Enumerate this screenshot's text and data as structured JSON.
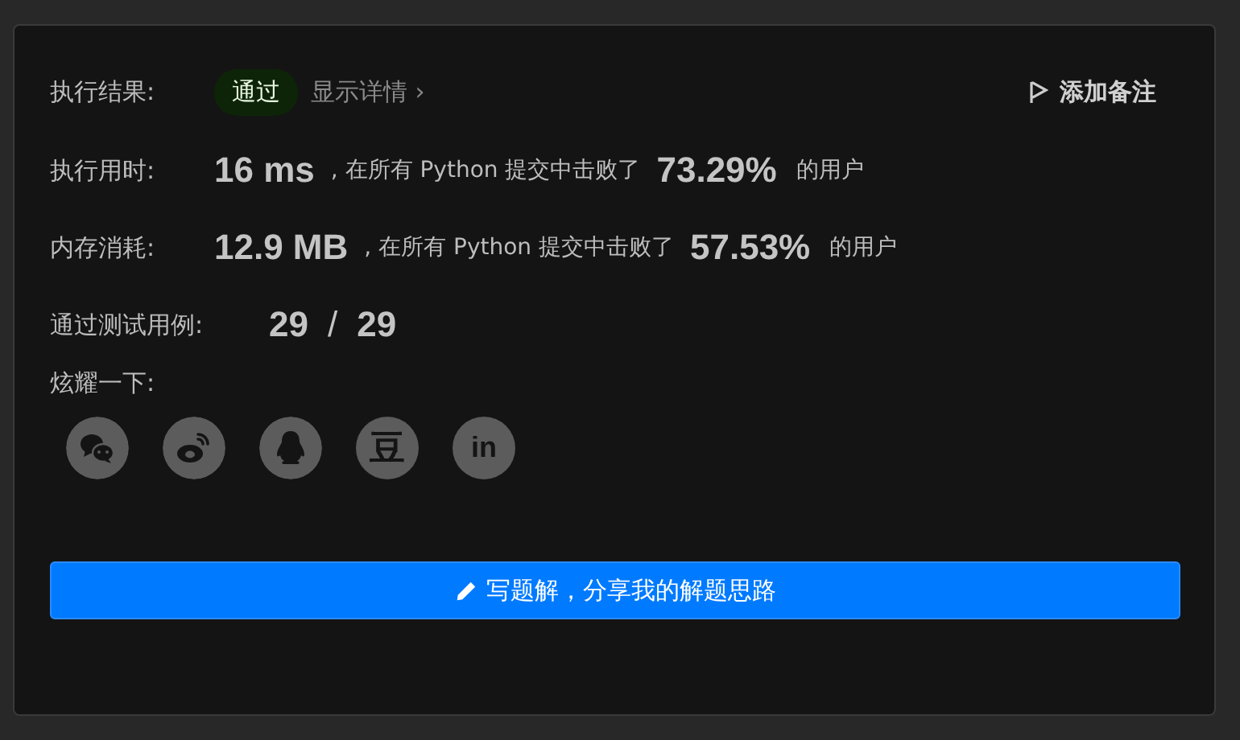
{
  "result": {
    "label": "执行结果:",
    "status": "通过",
    "details_link": "显示详情",
    "details_chevron": "›",
    "add_note": "添加备注"
  },
  "stats": [
    {
      "label": "执行用时:",
      "value": "16 ms",
      "middle": ", 在所有 Python 提交中击败了",
      "percent": "73.29%",
      "suffix": "的用户"
    },
    {
      "label": "内存消耗:",
      "value": "12.9 MB",
      "middle": ", 在所有 Python 提交中击败了",
      "percent": "57.53%",
      "suffix": "的用户"
    }
  ],
  "tests": {
    "label": "通过测试用例:",
    "passed": "29",
    "separator": "/",
    "total": "29"
  },
  "share": {
    "label": "炫耀一下:",
    "items": [
      {
        "kind": "wechat"
      },
      {
        "kind": "weibo"
      },
      {
        "kind": "qq"
      },
      {
        "kind": "text",
        "text": "豆"
      },
      {
        "kind": "text",
        "text": "in"
      }
    ]
  },
  "action_button": "写题解，分享我的解题思路"
}
